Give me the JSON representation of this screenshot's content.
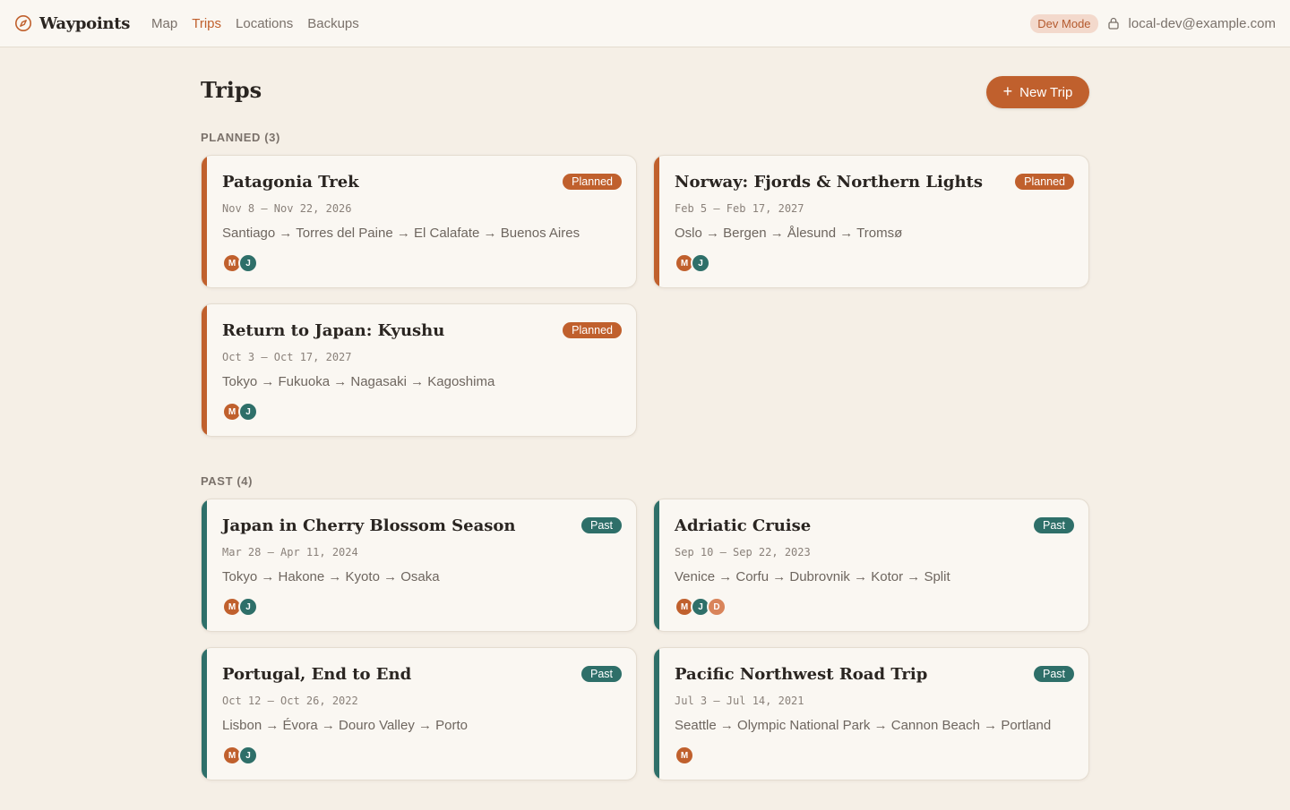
{
  "header": {
    "brand": "Waypoints",
    "nav": [
      {
        "label": "Map",
        "active": false
      },
      {
        "label": "Trips",
        "active": true
      },
      {
        "label": "Locations",
        "active": false
      },
      {
        "label": "Backups",
        "active": false
      }
    ],
    "dev_badge": "Dev Mode",
    "user_email": "local-dev@example.com"
  },
  "page": {
    "title": "Trips",
    "new_trip_label": "New Trip"
  },
  "colors": {
    "accent": "#c0602d",
    "past": "#2e6f69",
    "avatar_d": "#d9845a"
  },
  "sections": {
    "planned": {
      "label": "PLANNED (3)",
      "trips": [
        {
          "title": "Patagonia Trek",
          "status": "Planned",
          "dates": "Nov 8 – Nov 22, 2026",
          "route": "Santiago → Torres del Paine → El Calafate → Buenos Aires",
          "members": [
            "M",
            "J"
          ]
        },
        {
          "title": "Norway: Fjords & Northern Lights",
          "status": "Planned",
          "dates": "Feb 5 – Feb 17, 2027",
          "route": "Oslo → Bergen → Ålesund → Tromsø",
          "members": [
            "M",
            "J"
          ]
        },
        {
          "title": "Return to Japan: Kyushu",
          "status": "Planned",
          "dates": "Oct 3 – Oct 17, 2027",
          "route": "Tokyo → Fukuoka → Nagasaki → Kagoshima",
          "members": [
            "M",
            "J"
          ]
        }
      ]
    },
    "past": {
      "label": "PAST (4)",
      "trips": [
        {
          "title": "Japan in Cherry Blossom Season",
          "status": "Past",
          "dates": "Mar 28 – Apr 11, 2024",
          "route": "Tokyo → Hakone → Kyoto → Osaka",
          "members": [
            "M",
            "J"
          ]
        },
        {
          "title": "Adriatic Cruise",
          "status": "Past",
          "dates": "Sep 10 – Sep 22, 2023",
          "route": "Venice → Corfu → Dubrovnik → Kotor → Split",
          "members": [
            "M",
            "J",
            "D"
          ]
        },
        {
          "title": "Portugal, End to End",
          "status": "Past",
          "dates": "Oct 12 – Oct 26, 2022",
          "route": "Lisbon → Évora → Douro Valley → Porto",
          "members": [
            "M",
            "J"
          ]
        },
        {
          "title": "Pacific Northwest Road Trip",
          "status": "Past",
          "dates": "Jul 3 – Jul 14, 2021",
          "route": "Seattle → Olympic National Park → Cannon Beach → Portland",
          "members": [
            "M"
          ]
        }
      ]
    }
  }
}
